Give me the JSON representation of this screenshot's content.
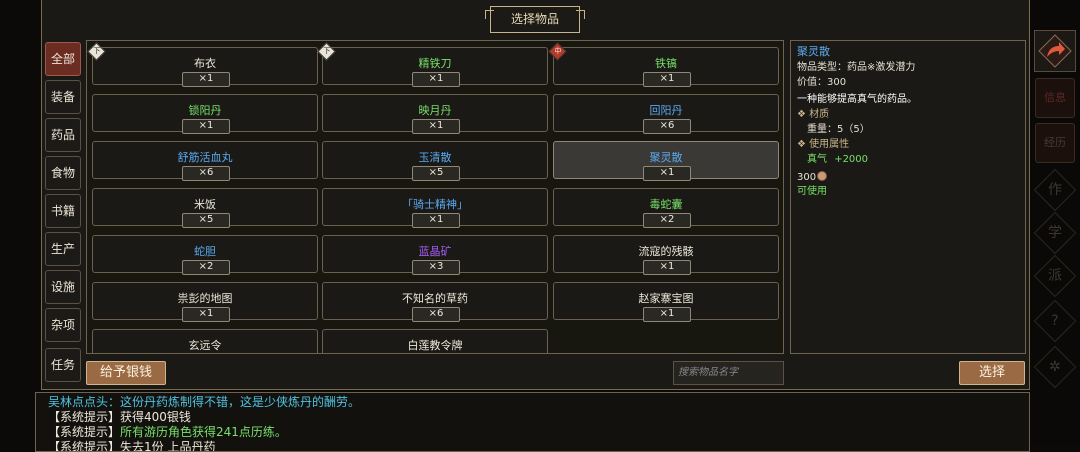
{
  "dialog": {
    "title": "选择物品"
  },
  "categories": [
    {
      "label": "全部",
      "active": true
    },
    {
      "label": "装备",
      "active": false
    },
    {
      "label": "药品",
      "active": false
    },
    {
      "label": "食物",
      "active": false
    },
    {
      "label": "书籍",
      "active": false
    },
    {
      "label": "生产",
      "active": false
    },
    {
      "label": "设施",
      "active": false
    },
    {
      "label": "杂项",
      "active": false
    },
    {
      "label": "任务",
      "active": false
    }
  ],
  "items": [
    {
      "name": "布衣",
      "qty": "×1",
      "color": "#ede7da",
      "tag": "下"
    },
    {
      "name": "精铁刀",
      "qty": "×1",
      "color": "#78e06a",
      "tag": "下"
    },
    {
      "name": "铁镐",
      "qty": "×1",
      "color": "#78e06a",
      "tag": "中"
    },
    {
      "name": "锁阳丹",
      "qty": "×1",
      "color": "#78e06a"
    },
    {
      "name": "映月丹",
      "qty": "×1",
      "color": "#78e06a"
    },
    {
      "name": "回阳丹",
      "qty": "×6",
      "color": "#5aa8f0"
    },
    {
      "name": "舒筋活血丸",
      "qty": "×6",
      "color": "#5aa8f0"
    },
    {
      "name": "玉清散",
      "qty": "×5",
      "color": "#5aa8f0"
    },
    {
      "name": "聚灵散",
      "qty": "×1",
      "color": "#5aa8f0",
      "selected": true
    },
    {
      "name": "米饭",
      "qty": "×5",
      "color": "#ede7da"
    },
    {
      "name": "「骑士精神」",
      "qty": "×1",
      "color": "#5aa8f0"
    },
    {
      "name": "毒蛇囊",
      "qty": "×2",
      "color": "#78e06a"
    },
    {
      "name": "蛇胆",
      "qty": "×2",
      "color": "#5aa8f0"
    },
    {
      "name": "蓝晶矿",
      "qty": "×3",
      "color": "#a35cf0"
    },
    {
      "name": "流寇的残骸",
      "qty": "×1",
      "color": "#ede7da"
    },
    {
      "name": "祟彭的地图",
      "qty": "×1",
      "color": "#ede7da"
    },
    {
      "name": "不知名的草药",
      "qty": "×6",
      "color": "#ede7da"
    },
    {
      "name": "赵家寨宝图",
      "qty": "×1",
      "color": "#ede7da"
    },
    {
      "name": "玄远令",
      "qty": "",
      "color": "#ede7da"
    },
    {
      "name": "白莲教令牌",
      "qty": "",
      "color": "#ede7da"
    }
  ],
  "detail": {
    "name": "聚灵散",
    "type_line": "物品类型：药品※激发潜力",
    "value_line": "价值：300",
    "description": "一种能够提高真气的药品。",
    "material_header": "材质",
    "weight_line": "重量：5（5）",
    "use_header": "使用属性",
    "use_stat": "真气",
    "use_value": "+2000",
    "price": "300",
    "usable": "可使用"
  },
  "buttons": {
    "give_money": "给予银钱",
    "select": "选择"
  },
  "search": {
    "placeholder": "搜索物品名字"
  },
  "sidebar": [
    {
      "label": "信息",
      "icon": "info-icon"
    },
    {
      "label": "经历",
      "icon": "history-icon"
    }
  ],
  "log": [
    {
      "prefix": "吴林点点头：",
      "text": "这份丹药炼制得不错，这是少侠炼丹的酬劳。",
      "prefix_color": "#4fc3e0",
      "text_color": "#4fc3e0"
    },
    {
      "prefix": "【系统提示】",
      "text": "获得400银钱",
      "prefix_color": "#ede7da",
      "text_color": "#ede7da"
    },
    {
      "prefix": "【系统提示】",
      "text": "所有游历角色获得241点历练。",
      "prefix_color": "#ede7da",
      "text_color": "#78e06a"
    },
    {
      "prefix": "【系统提示】",
      "text": "失去1份 上品丹药",
      "prefix_color": "#ede7da",
      "text_color": "#ede7da"
    }
  ],
  "colors": {
    "accent": "#9a6a44",
    "active_tab": "#6b2c22",
    "gold_border": "#c9b48a"
  }
}
